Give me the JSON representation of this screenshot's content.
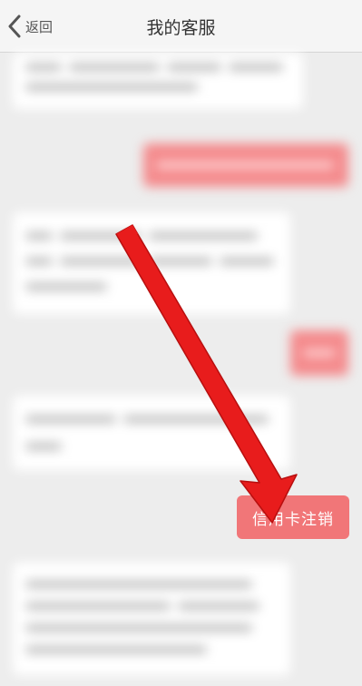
{
  "header": {
    "back_label": "返回",
    "title": "我的客服"
  },
  "chat": {
    "highlight_message": "信用卡注销"
  },
  "colors": {
    "outgoing_bubble": "#f48a8c",
    "highlight_bubble": "#f17678",
    "arrow": "#e81c1c"
  },
  "icons": {
    "back": "chevron-left-icon",
    "annotation": "red-arrow-annotation"
  }
}
